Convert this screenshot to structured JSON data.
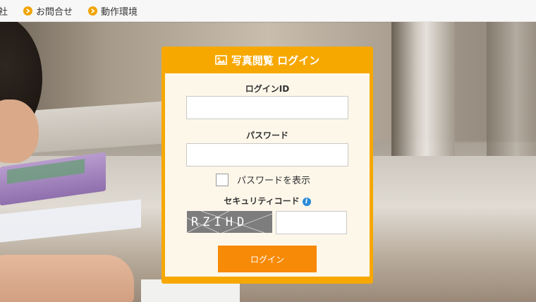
{
  "nav": {
    "items": [
      {
        "label": "社"
      },
      {
        "label": "お問合せ"
      },
      {
        "label": "動作環境"
      }
    ]
  },
  "login": {
    "title": "写真閲覧 ログイン",
    "id_label": "ログインID",
    "id_value": "",
    "password_label": "パスワード",
    "password_value": "",
    "show_password_label": "パスワードを表示",
    "security_code_label": "セキュリティコード",
    "captcha_text": "RZIHD",
    "security_code_value": "",
    "submit_label": "ログイン"
  },
  "colors": {
    "panel_accent": "#f7a800",
    "button": "#f78a06",
    "panel_body": "#fdf7ea",
    "info_icon": "#2b8bd8"
  },
  "icons": {
    "nav_item": "arrow-circle-icon",
    "title": "image-icon",
    "security_help": "info-icon"
  }
}
